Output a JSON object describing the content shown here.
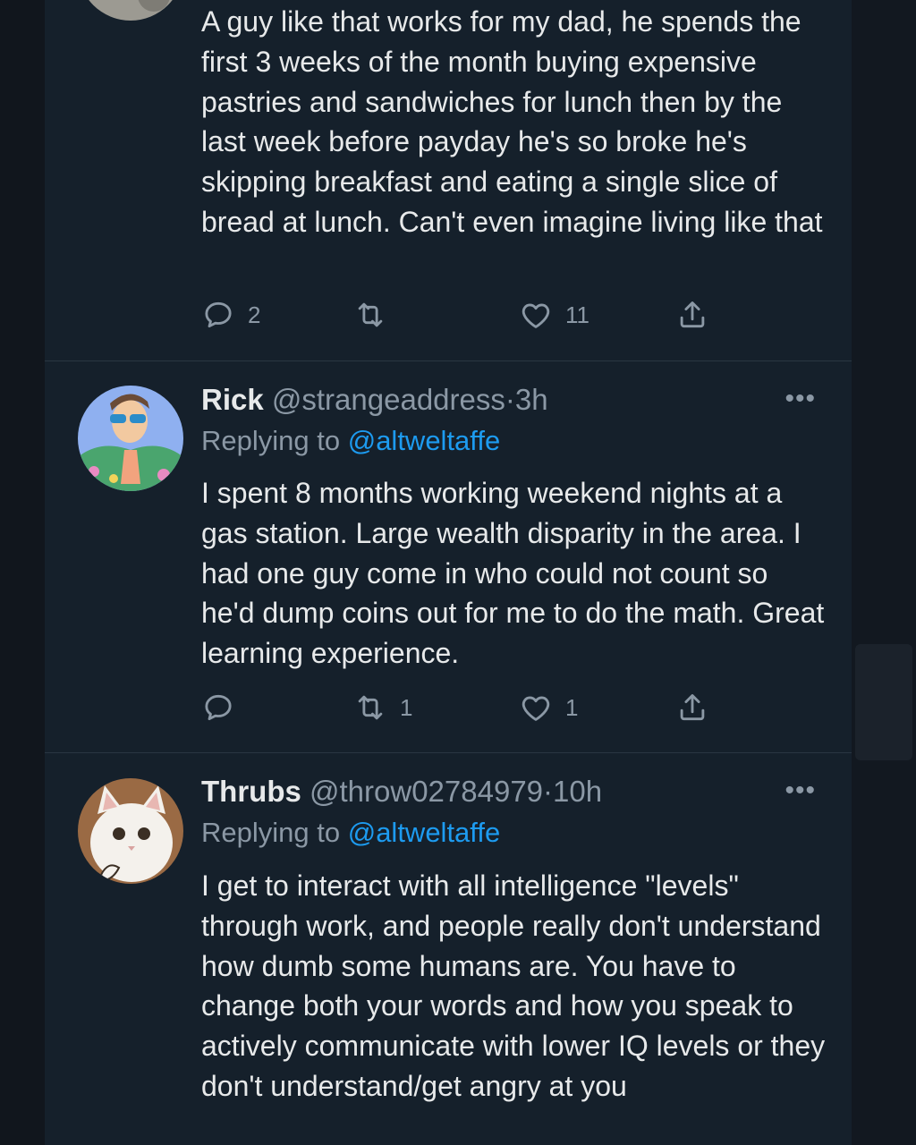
{
  "tweets": [
    {
      "text": "A guy like that works for my dad, he spends the first 3 weeks of the month buying expensive pastries and sandwiches for lunch then by the last week before payday he's so broke he's skipping breakfast and eating a single slice of bread at lunch. Can't even imagine living like that",
      "stats": {
        "replies": "2",
        "retweets": "",
        "likes": "11"
      }
    },
    {
      "name": "Rick",
      "handle": "@strangeaddress",
      "sep": "·",
      "time": "3h",
      "more": "•••",
      "replying_prefix": "Replying to ",
      "replying_to": "@altweltaffe",
      "text": "I spent 8 months working weekend nights at a gas station. Large wealth disparity in the area. I had one guy come in who could not count so he'd dump coins out for me to do the math. Great learning experience.",
      "stats": {
        "replies": "",
        "retweets": "1",
        "likes": "1"
      }
    },
    {
      "name": "Thrubs",
      "handle": "@throw02784979",
      "sep": "·",
      "time": "10h",
      "more": "•••",
      "replying_prefix": "Replying to ",
      "replying_to": "@altweltaffe",
      "text": "I get to interact with all intelligence \"levels\" through work, and people really don't understand how dumb some humans are. You have to change both your words and how you speak to actively communicate with lower IQ levels or they don't understand/get angry at you"
    }
  ],
  "icons": {
    "reply": "speech-bubble-icon",
    "retweet": "retweet-arrows-icon",
    "like": "heart-icon",
    "share": "share-upload-icon",
    "more": "ellipsis-icon"
  },
  "colors": {
    "background": "#15202b",
    "text": "#e7e9ea",
    "muted": "#8b98a5",
    "accent": "#1d9bf0",
    "divider": "#2a3642"
  }
}
